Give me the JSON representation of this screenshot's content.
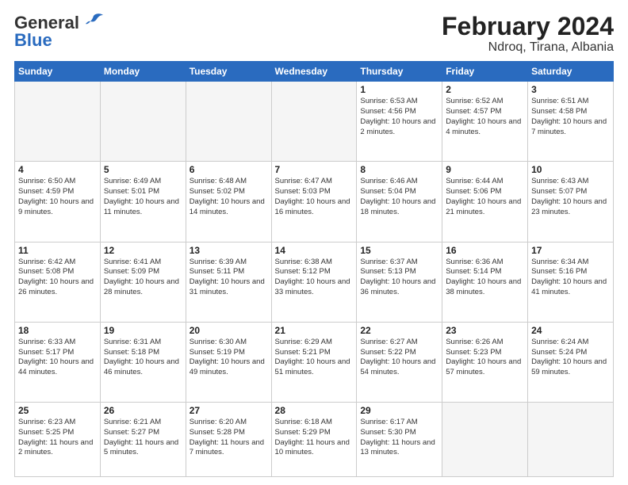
{
  "logo": {
    "line1": "General",
    "line2": "Blue"
  },
  "title": "February 2024",
  "subtitle": "Ndroq, Tirana, Albania",
  "days_of_week": [
    "Sunday",
    "Monday",
    "Tuesday",
    "Wednesday",
    "Thursday",
    "Friday",
    "Saturday"
  ],
  "weeks": [
    [
      {
        "day": "",
        "info": ""
      },
      {
        "day": "",
        "info": ""
      },
      {
        "day": "",
        "info": ""
      },
      {
        "day": "",
        "info": ""
      },
      {
        "day": "1",
        "info": "Sunrise: 6:53 AM\nSunset: 4:56 PM\nDaylight: 10 hours and 2 minutes."
      },
      {
        "day": "2",
        "info": "Sunrise: 6:52 AM\nSunset: 4:57 PM\nDaylight: 10 hours and 4 minutes."
      },
      {
        "day": "3",
        "info": "Sunrise: 6:51 AM\nSunset: 4:58 PM\nDaylight: 10 hours and 7 minutes."
      }
    ],
    [
      {
        "day": "4",
        "info": "Sunrise: 6:50 AM\nSunset: 4:59 PM\nDaylight: 10 hours and 9 minutes."
      },
      {
        "day": "5",
        "info": "Sunrise: 6:49 AM\nSunset: 5:01 PM\nDaylight: 10 hours and 11 minutes."
      },
      {
        "day": "6",
        "info": "Sunrise: 6:48 AM\nSunset: 5:02 PM\nDaylight: 10 hours and 14 minutes."
      },
      {
        "day": "7",
        "info": "Sunrise: 6:47 AM\nSunset: 5:03 PM\nDaylight: 10 hours and 16 minutes."
      },
      {
        "day": "8",
        "info": "Sunrise: 6:46 AM\nSunset: 5:04 PM\nDaylight: 10 hours and 18 minutes."
      },
      {
        "day": "9",
        "info": "Sunrise: 6:44 AM\nSunset: 5:06 PM\nDaylight: 10 hours and 21 minutes."
      },
      {
        "day": "10",
        "info": "Sunrise: 6:43 AM\nSunset: 5:07 PM\nDaylight: 10 hours and 23 minutes."
      }
    ],
    [
      {
        "day": "11",
        "info": "Sunrise: 6:42 AM\nSunset: 5:08 PM\nDaylight: 10 hours and 26 minutes."
      },
      {
        "day": "12",
        "info": "Sunrise: 6:41 AM\nSunset: 5:09 PM\nDaylight: 10 hours and 28 minutes."
      },
      {
        "day": "13",
        "info": "Sunrise: 6:39 AM\nSunset: 5:11 PM\nDaylight: 10 hours and 31 minutes."
      },
      {
        "day": "14",
        "info": "Sunrise: 6:38 AM\nSunset: 5:12 PM\nDaylight: 10 hours and 33 minutes."
      },
      {
        "day": "15",
        "info": "Sunrise: 6:37 AM\nSunset: 5:13 PM\nDaylight: 10 hours and 36 minutes."
      },
      {
        "day": "16",
        "info": "Sunrise: 6:36 AM\nSunset: 5:14 PM\nDaylight: 10 hours and 38 minutes."
      },
      {
        "day": "17",
        "info": "Sunrise: 6:34 AM\nSunset: 5:16 PM\nDaylight: 10 hours and 41 minutes."
      }
    ],
    [
      {
        "day": "18",
        "info": "Sunrise: 6:33 AM\nSunset: 5:17 PM\nDaylight: 10 hours and 44 minutes."
      },
      {
        "day": "19",
        "info": "Sunrise: 6:31 AM\nSunset: 5:18 PM\nDaylight: 10 hours and 46 minutes."
      },
      {
        "day": "20",
        "info": "Sunrise: 6:30 AM\nSunset: 5:19 PM\nDaylight: 10 hours and 49 minutes."
      },
      {
        "day": "21",
        "info": "Sunrise: 6:29 AM\nSunset: 5:21 PM\nDaylight: 10 hours and 51 minutes."
      },
      {
        "day": "22",
        "info": "Sunrise: 6:27 AM\nSunset: 5:22 PM\nDaylight: 10 hours and 54 minutes."
      },
      {
        "day": "23",
        "info": "Sunrise: 6:26 AM\nSunset: 5:23 PM\nDaylight: 10 hours and 57 minutes."
      },
      {
        "day": "24",
        "info": "Sunrise: 6:24 AM\nSunset: 5:24 PM\nDaylight: 10 hours and 59 minutes."
      }
    ],
    [
      {
        "day": "25",
        "info": "Sunrise: 6:23 AM\nSunset: 5:25 PM\nDaylight: 11 hours and 2 minutes."
      },
      {
        "day": "26",
        "info": "Sunrise: 6:21 AM\nSunset: 5:27 PM\nDaylight: 11 hours and 5 minutes."
      },
      {
        "day": "27",
        "info": "Sunrise: 6:20 AM\nSunset: 5:28 PM\nDaylight: 11 hours and 7 minutes."
      },
      {
        "day": "28",
        "info": "Sunrise: 6:18 AM\nSunset: 5:29 PM\nDaylight: 11 hours and 10 minutes."
      },
      {
        "day": "29",
        "info": "Sunrise: 6:17 AM\nSunset: 5:30 PM\nDaylight: 11 hours and 13 minutes."
      },
      {
        "day": "",
        "info": ""
      },
      {
        "day": "",
        "info": ""
      }
    ]
  ]
}
